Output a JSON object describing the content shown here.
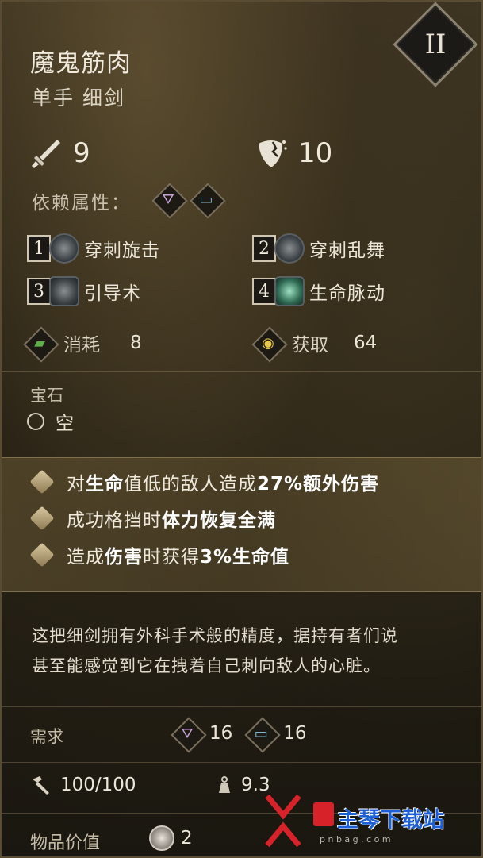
{
  "item": {
    "name": "魔鬼筋肉",
    "type": "单手 细剑",
    "level_badge": "II"
  },
  "stats": {
    "attack": "9",
    "defense": "10"
  },
  "scaling": {
    "label": "依赖属性："
  },
  "skills": [
    {
      "num": "1",
      "name": "穿刺旋击"
    },
    {
      "num": "2",
      "name": "穿刺乱舞"
    },
    {
      "num": "3",
      "name": "引导术"
    },
    {
      "num": "4",
      "name": "生命脉动"
    }
  ],
  "economy": {
    "cost_label": "消耗",
    "cost_value": "8",
    "gain_label": "获取",
    "gain_value": "64"
  },
  "gem": {
    "label": "宝石",
    "slot_value": "空"
  },
  "effects": [
    {
      "pre": "对",
      "b1": "生命",
      "mid1": "值低的敌人造成",
      "b2": "27%额外伤害",
      "post": ""
    },
    {
      "pre": "成功格挡时",
      "b1": "体力恢复全满",
      "mid1": "",
      "b2": "",
      "post": ""
    },
    {
      "pre": "造成",
      "b1": "伤害",
      "mid1": "时获得",
      "b2": "3%生命值",
      "post": ""
    }
  ],
  "description": {
    "line1": "这把细剑拥有外科手术般的精度，据持有者们说",
    "line2": "甚至能感觉到它在拽着自己刺向敌人的心脏。"
  },
  "requirements": {
    "label": "需求",
    "faith": "16",
    "arcane": "16"
  },
  "durability": {
    "value": "100/100"
  },
  "weight": {
    "value": "9.3"
  },
  "value": {
    "label": "物品价值",
    "amount": "2"
  },
  "watermark": {
    "main": "主琴下载站",
    "sub": "p n b a g . c o m"
  },
  "colors": {
    "faith_icon": "#c9a3d6",
    "arcane_icon": "#7fb6c9",
    "cost_icon": "#5fae4a",
    "gain_icon": "#e6c84a",
    "watermark_red": "#d8222a"
  }
}
